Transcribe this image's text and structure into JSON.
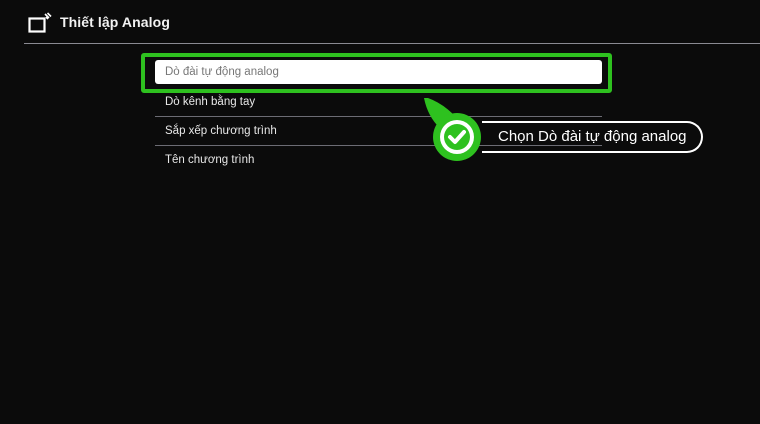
{
  "header": {
    "title": "Thiết lập Analog",
    "icon": "tv-antenna-icon"
  },
  "menu": {
    "items": [
      {
        "label": "Dò đài tự động analog",
        "selected": true
      },
      {
        "label": "Dò kênh bằng tay",
        "selected": false
      },
      {
        "label": "Sắp xếp chương trình",
        "selected": false
      },
      {
        "label": "Tên chương trình",
        "selected": false
      }
    ]
  },
  "callout": {
    "text": "Chọn Dò đài tự động analog",
    "icon": "checkmark-icon"
  },
  "colors": {
    "background": "#0b0b0b",
    "highlight": "#2ec11f",
    "selected_bg": "#ffffff"
  }
}
